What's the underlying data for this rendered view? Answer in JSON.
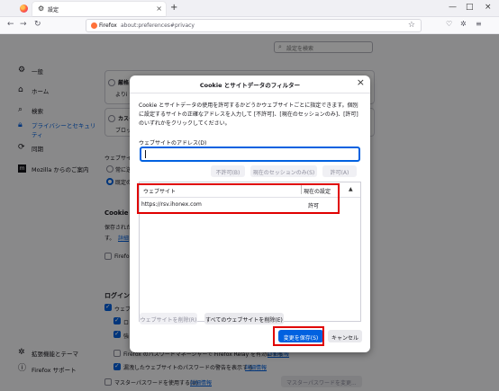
{
  "tab": {
    "title": "設定"
  },
  "urlbar": {
    "brand": "Firefox",
    "url": "about:preferences#privacy"
  },
  "search": {
    "placeholder": "設定を検索"
  },
  "sidebar": {
    "items": [
      {
        "label": "一般",
        "icon": "gear-icon"
      },
      {
        "label": "ホーム",
        "icon": "home-icon"
      },
      {
        "label": "検索",
        "icon": "search-icon"
      },
      {
        "label": "プライバシーとセキュリティ",
        "icon": "lock-icon"
      },
      {
        "label": "同期",
        "icon": "sync-icon"
      },
      {
        "label": "Mozilla からのご案内",
        "icon": "mozilla-icon"
      }
    ],
    "footer": [
      {
        "label": "拡張機能とテーマ",
        "icon": "extension-icon"
      },
      {
        "label": "Firefox サポート",
        "icon": "help-icon"
      }
    ]
  },
  "background": {
    "strict_label": "厳格",
    "strict_sub": "よりi",
    "custom_label": "カスタ",
    "custom_sub": "ブロッ",
    "website_label": "ウェブサイ",
    "always_label": "常に送",
    "default_label": "既定の",
    "cookie_heading": "Cookie",
    "cookie_desc": "保存された",
    "cookie_desc2": "す。",
    "details_link": "詳細",
    "firefox_label": "Firefo",
    "login_heading": "ログインと",
    "check1": "ウェブ",
    "check2": "ロ",
    "check3": "強",
    "relay_text": "Firefox のパスワードマネージャーで Firefox Relay を有効にする",
    "relay_link": "詳細情報",
    "breach_text": "漏洩したウェブサイトのパスワードの警告を表示する",
    "breach_link": "詳細情報",
    "master_text": "マスターパスワードを使用する(U)",
    "master_link": "詳細情報",
    "master_btn": "マスターパスワードを変更..."
  },
  "dialog": {
    "title": "Cookie とサイトデータのフィルター",
    "description": "Cookie とサイトデータの使用を許可するかどうかウェブサイトごとに指定できます。個別に設定するサイトの正確なアドレスを入力して [不許可]、[現在のセッションのみ]、[許可] のいずれかをクリックしてください。",
    "address_label": "ウェブサイトのアドレス(D)",
    "address_value": "",
    "block_btn": "不許可(B)",
    "session_btn": "現在のセッションのみ(S)",
    "allow_btn": "許可(A)",
    "col_website": "ウェブサイト",
    "col_status": "現在の設定",
    "rows": [
      {
        "site": "https://rsv.ihonex.com",
        "status": "許可"
      }
    ],
    "remove_btn": "ウェブサイトを削除(R)",
    "remove_all_btn": "すべてのウェブサイトを削除(E)",
    "save_btn": "変更を保存(S)",
    "cancel_btn": "キャンセル"
  }
}
